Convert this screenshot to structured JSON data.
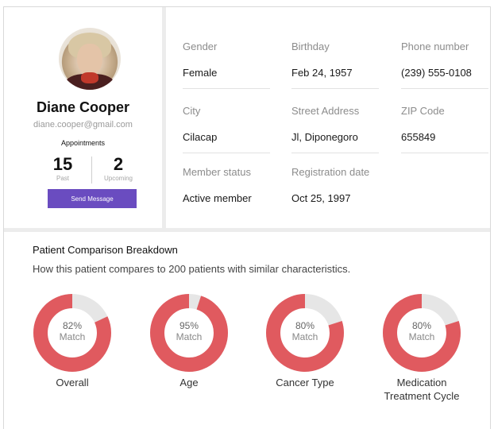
{
  "profile": {
    "name": "Diane Cooper",
    "email": "diane.cooper@gmail.com",
    "appointments_title": "Appointments",
    "past": {
      "count": "15",
      "label": "Past"
    },
    "upcoming": {
      "count": "2",
      "label": "Upcoming"
    },
    "send_message_label": "Send Message",
    "button_color": "#6a4cc0"
  },
  "details": {
    "gender": {
      "label": "Gender",
      "value": "Female"
    },
    "birthday": {
      "label": "Birthday",
      "value": "Feb 24, 1957"
    },
    "phone": {
      "label": "Phone number",
      "value": "(239) 555-0108"
    },
    "city": {
      "label": "City",
      "value": "Cilacap"
    },
    "street": {
      "label": "Street Address",
      "value": "Jl, Diponegoro"
    },
    "zip": {
      "label": "ZIP Code",
      "value": "655849"
    },
    "member_status": {
      "label": "Member status",
      "value": "Active member"
    },
    "registration": {
      "label": "Registration date",
      "value": "Oct 25, 1997"
    }
  },
  "comparison": {
    "title": "Patient Comparison Breakdown",
    "subtitle": "How this patient compares to 200 patients with similar characteristics.",
    "match_word": "Match",
    "accent_color": "#e05a5f",
    "track_color": "#e6e6e6",
    "items": [
      {
        "percent": 82,
        "percent_label": "82%",
        "label": "Overall"
      },
      {
        "percent": 95,
        "percent_label": "95%",
        "label": "Age"
      },
      {
        "percent": 80,
        "percent_label": "80%",
        "label": "Cancer Type"
      },
      {
        "percent": 80,
        "percent_label": "80%",
        "label": "Medication\nTreatment Cycle"
      }
    ]
  }
}
